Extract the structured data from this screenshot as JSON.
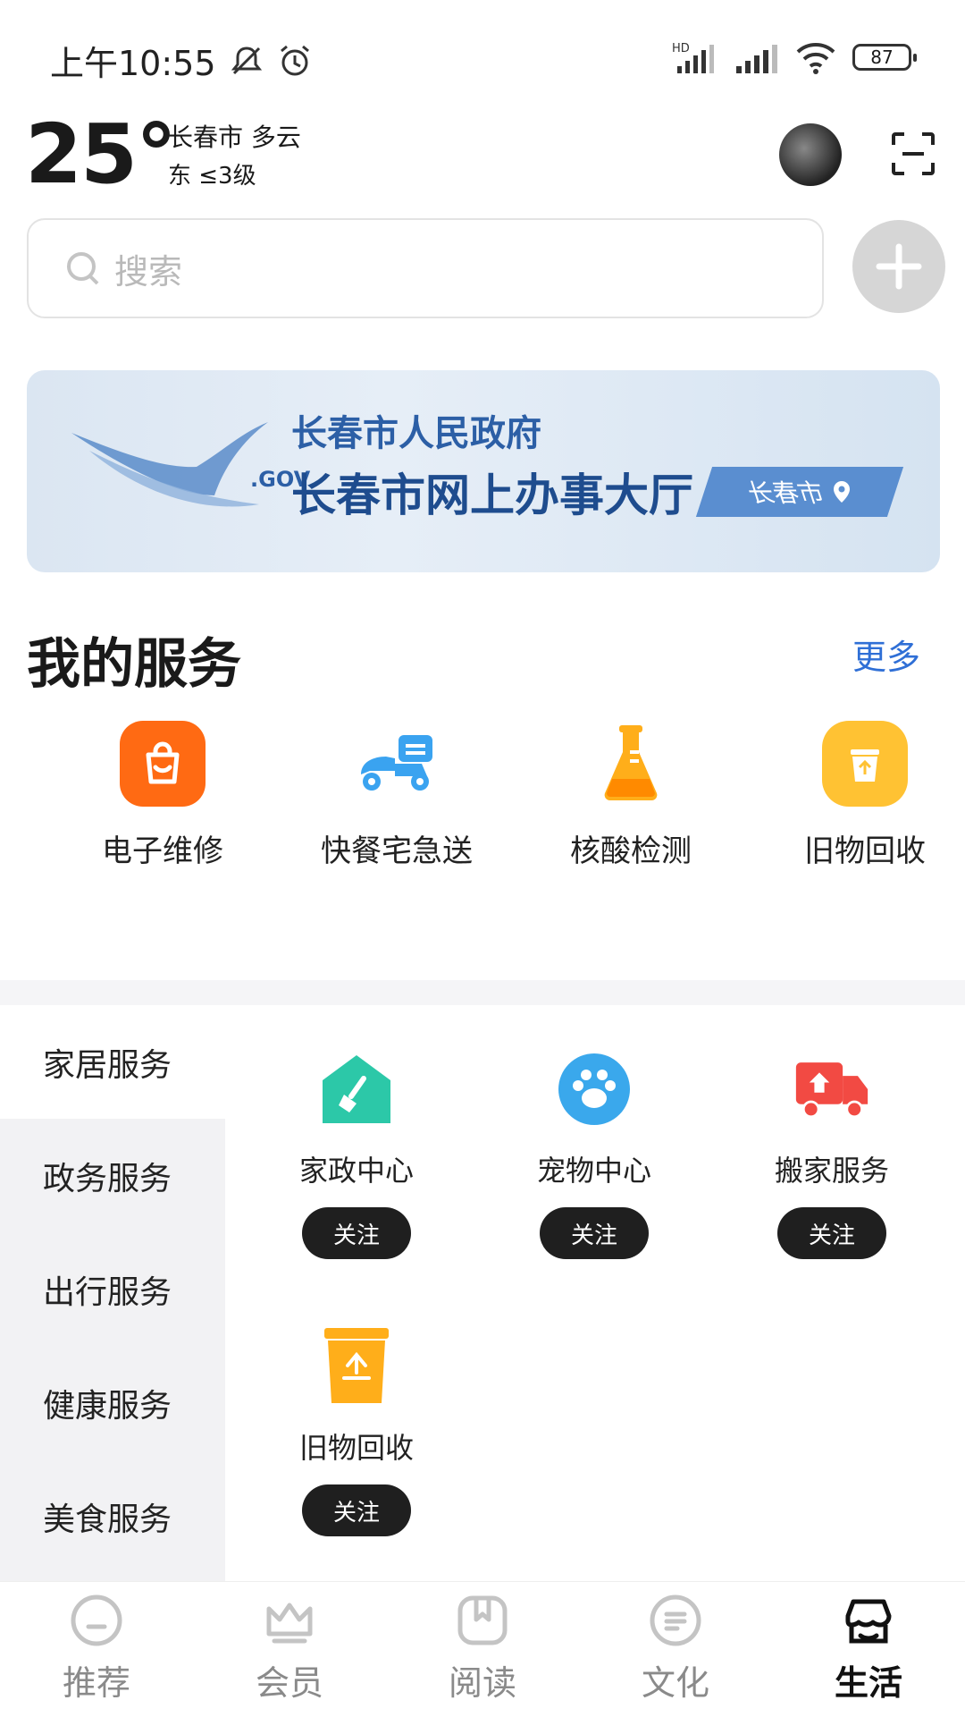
{
  "status_bar": {
    "time": "上午10:55",
    "battery": "87",
    "network": "HD"
  },
  "weather": {
    "temp": "25°",
    "city_cond": "长春市 多云",
    "wind": "东 ≤3级"
  },
  "search": {
    "placeholder": "搜索"
  },
  "banner": {
    "line1": "长春市人民政府",
    "line2": "长春市网上办事大厅",
    "city": "长春市",
    "logo_text": ".GOV"
  },
  "my_services": {
    "title": "我的服务",
    "more": "更多",
    "items": [
      {
        "label": "电子维修",
        "icon": "shopping-bag-icon",
        "color": "#ff6a13"
      },
      {
        "label": "快餐宅急送",
        "icon": "scooter-icon",
        "color": "#3aa3f0"
      },
      {
        "label": "核酸检测",
        "icon": "flask-icon",
        "color": "#ffae1a"
      },
      {
        "label": "旧物回收",
        "icon": "recycle-bin-icon",
        "color": "#ffc233"
      }
    ]
  },
  "categories": {
    "items": [
      {
        "label": "家居服务",
        "active": true
      },
      {
        "label": "政务服务"
      },
      {
        "label": "出行服务"
      },
      {
        "label": "健康服务"
      },
      {
        "label": "美食服务"
      }
    ]
  },
  "category_services": {
    "follow_label": "关注",
    "items": [
      {
        "label": "家政中心",
        "icon": "house-broom-icon",
        "color": "#2cc8a8"
      },
      {
        "label": "宠物中心",
        "icon": "paw-icon",
        "color": "#3aa8ec"
      },
      {
        "label": "搬家服务",
        "icon": "moving-truck-icon",
        "color": "#f24a43"
      },
      {
        "label": "旧物回收",
        "icon": "recycle-bin-icon",
        "color": "#ffae1a"
      }
    ]
  },
  "bottom_nav": {
    "items": [
      {
        "label": "推荐"
      },
      {
        "label": "会员"
      },
      {
        "label": "阅读"
      },
      {
        "label": "文化"
      },
      {
        "label": "生活",
        "active": true
      }
    ]
  }
}
